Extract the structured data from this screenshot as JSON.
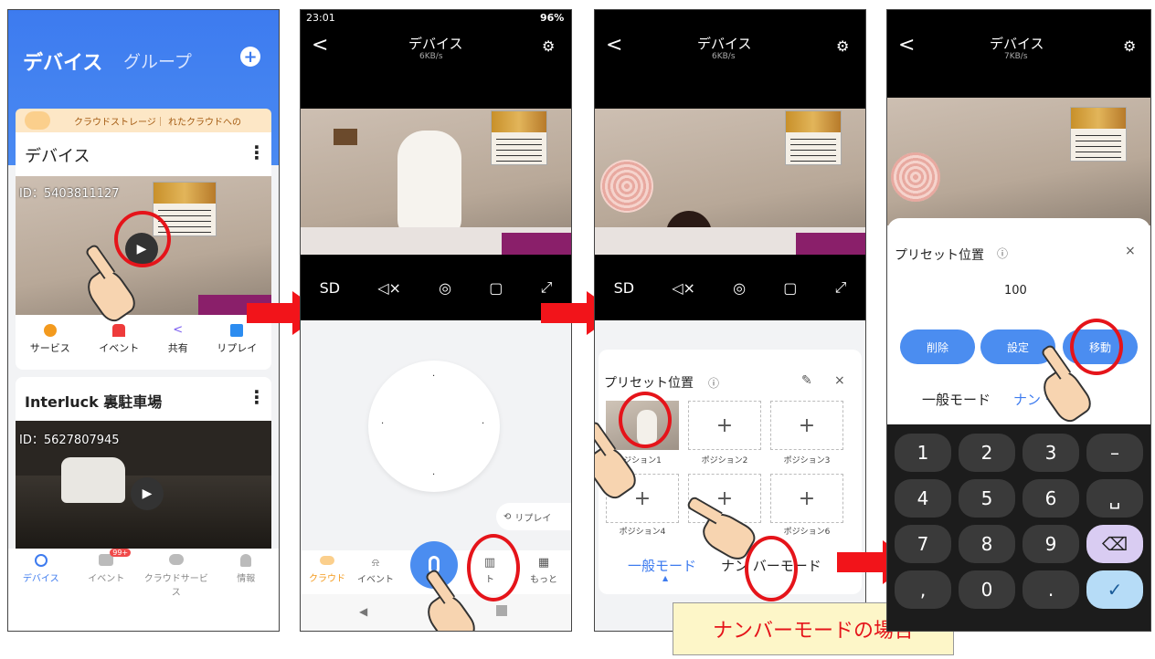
{
  "panel1": {
    "tab_devices": "デバイス",
    "tab_groups": "グループ",
    "add_icon": "plus-circle-icon",
    "banner_text": "クラウドストレージ｜ れたクラウドへの",
    "card1": {
      "title": "デバイス",
      "id_text": "ID：5403811127",
      "actions": [
        {
          "label": "サービス"
        },
        {
          "label": "イベント"
        },
        {
          "label": "共有"
        },
        {
          "label": "リプレイ"
        }
      ]
    },
    "card2": {
      "title": "Interluck 裏駐車場",
      "id_text": "ID：5627807945"
    },
    "bottom_nav": [
      {
        "label": "デバイス"
      },
      {
        "label": "イベント",
        "badge": "99+"
      },
      {
        "label": "クラウドサービス"
      },
      {
        "label": "情報"
      }
    ]
  },
  "panel2": {
    "status_time": "23:01",
    "status_battery": "96%",
    "title": "デバイス",
    "speed": "6KB/s",
    "replay_label": "リプレイ",
    "bottom_nav": [
      {
        "label": "クラウド"
      },
      {
        "label": "イベント"
      },
      {
        "label": "ト"
      },
      {
        "label": "もっと"
      }
    ]
  },
  "panel3": {
    "title": "デバイス",
    "speed": "6KB/s",
    "preset_title": "プリセット位置",
    "positions": [
      "ジション1",
      "ポジション2",
      "ポジション3",
      "ポジション4",
      "",
      "ポジション6"
    ],
    "mode_general": "一般モード",
    "mode_number": "ナン バーモード"
  },
  "panel4": {
    "title": "デバイス",
    "speed": "7KB/s",
    "preset_title": "プリセット位置",
    "number_value": "100",
    "btn_delete": "削除",
    "btn_set": "設定",
    "btn_move": "移動",
    "mode_general": "一般モード",
    "mode_number": "ナン ード",
    "keys": [
      "1",
      "2",
      "3",
      "–",
      "4",
      "5",
      "6",
      "␣",
      "7",
      "8",
      "9",
      "⌫",
      ",",
      "0",
      ".",
      "✓"
    ]
  },
  "caption": "ナンバーモードの場合",
  "colors": {
    "accent": "#4b8df0",
    "red": "#e5141a",
    "caption_bg": "#fdf6c8"
  }
}
